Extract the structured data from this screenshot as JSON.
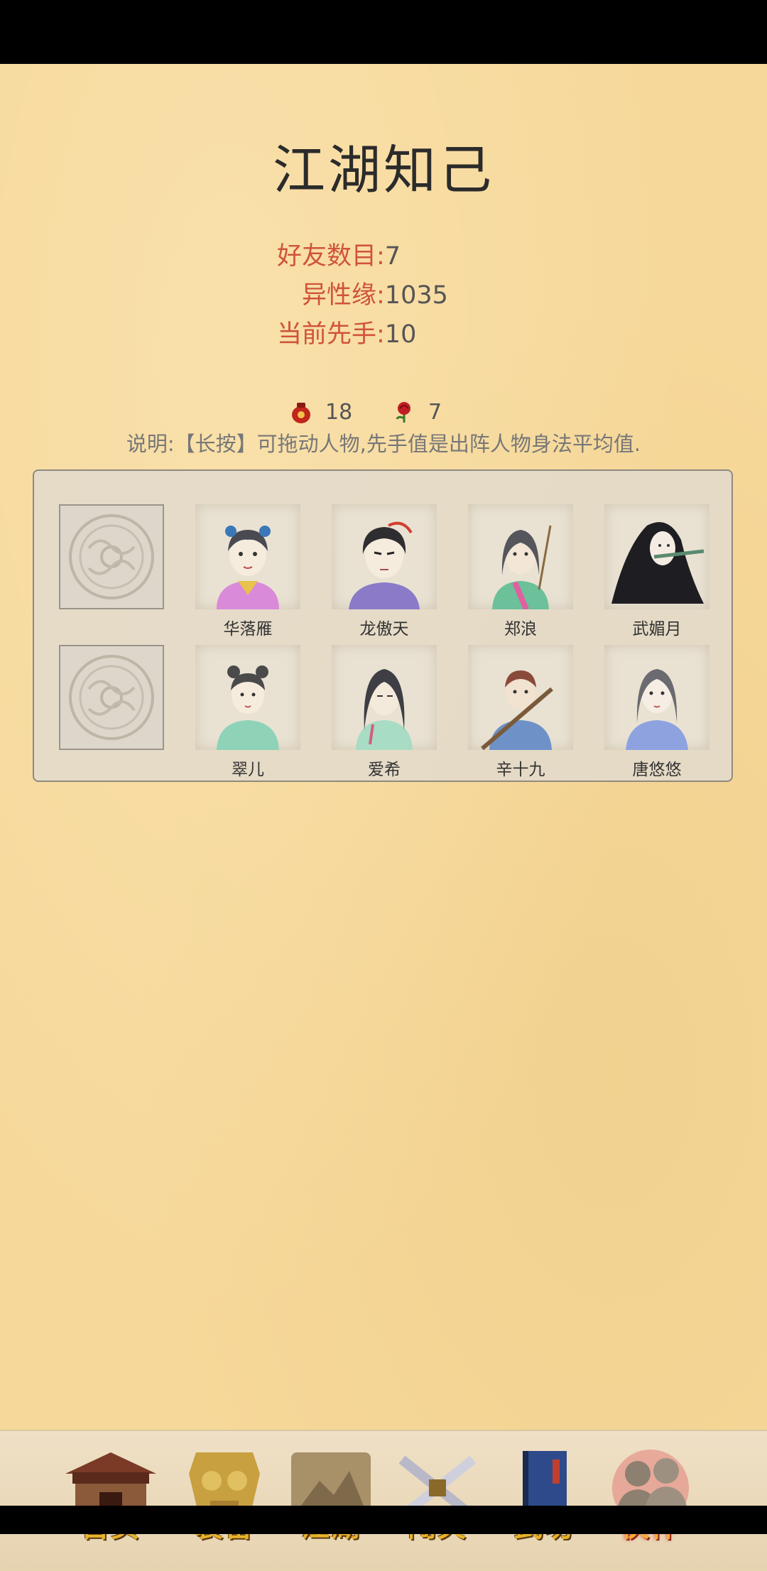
{
  "page": {
    "title": "江湖知己",
    "stats": [
      {
        "label": "好友数目:",
        "value": "7"
      },
      {
        "label": "异性缘:",
        "value": "1035"
      },
      {
        "label": "当前先手:",
        "value": "10"
      }
    ],
    "resources": {
      "wine_count": "18",
      "rose_count": "7"
    },
    "note": "说明:【长按】可拖动人物,先手值是出阵人物身法平均值."
  },
  "team": {
    "row1": [
      "华落雁",
      "龙傲天",
      "郑浪",
      "武媚月"
    ],
    "row2": [
      "翠儿",
      "爱希",
      "辛十九",
      "唐悠悠"
    ]
  },
  "nav": {
    "items": [
      {
        "label": "首页",
        "icon": "house-icon"
      },
      {
        "label": "装备",
        "icon": "armor-icon"
      },
      {
        "label": "江湖",
        "icon": "scroll-map-icon"
      },
      {
        "label": "闯关",
        "icon": "crossed-swords-icon"
      },
      {
        "label": "武功",
        "icon": "book-icon"
      },
      {
        "label": "伙伴",
        "icon": "companions-icon"
      }
    ],
    "active": "伙伴"
  },
  "colors": {
    "accent": "#d0533a",
    "background": "#f6d89a"
  }
}
